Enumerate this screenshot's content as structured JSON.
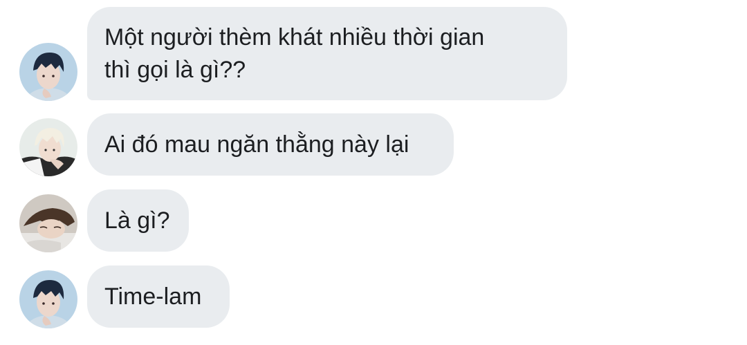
{
  "messages": [
    {
      "text": "Một người thèm khát nhiều thời gian\nthì gọi là gì??",
      "avatar": "user-avatar-dark-hair"
    },
    {
      "text": "Ai đó mau ngăn thằng này lại",
      "avatar": "user-avatar-blond-hair"
    },
    {
      "text": "Là gì?",
      "avatar": "user-avatar-brown-hair"
    },
    {
      "text": "Time-lam",
      "avatar": "user-avatar-dark-hair"
    }
  ],
  "colors": {
    "bubble_bg": "#e9ecef",
    "text": "#1c1e21",
    "background": "#ffffff"
  }
}
